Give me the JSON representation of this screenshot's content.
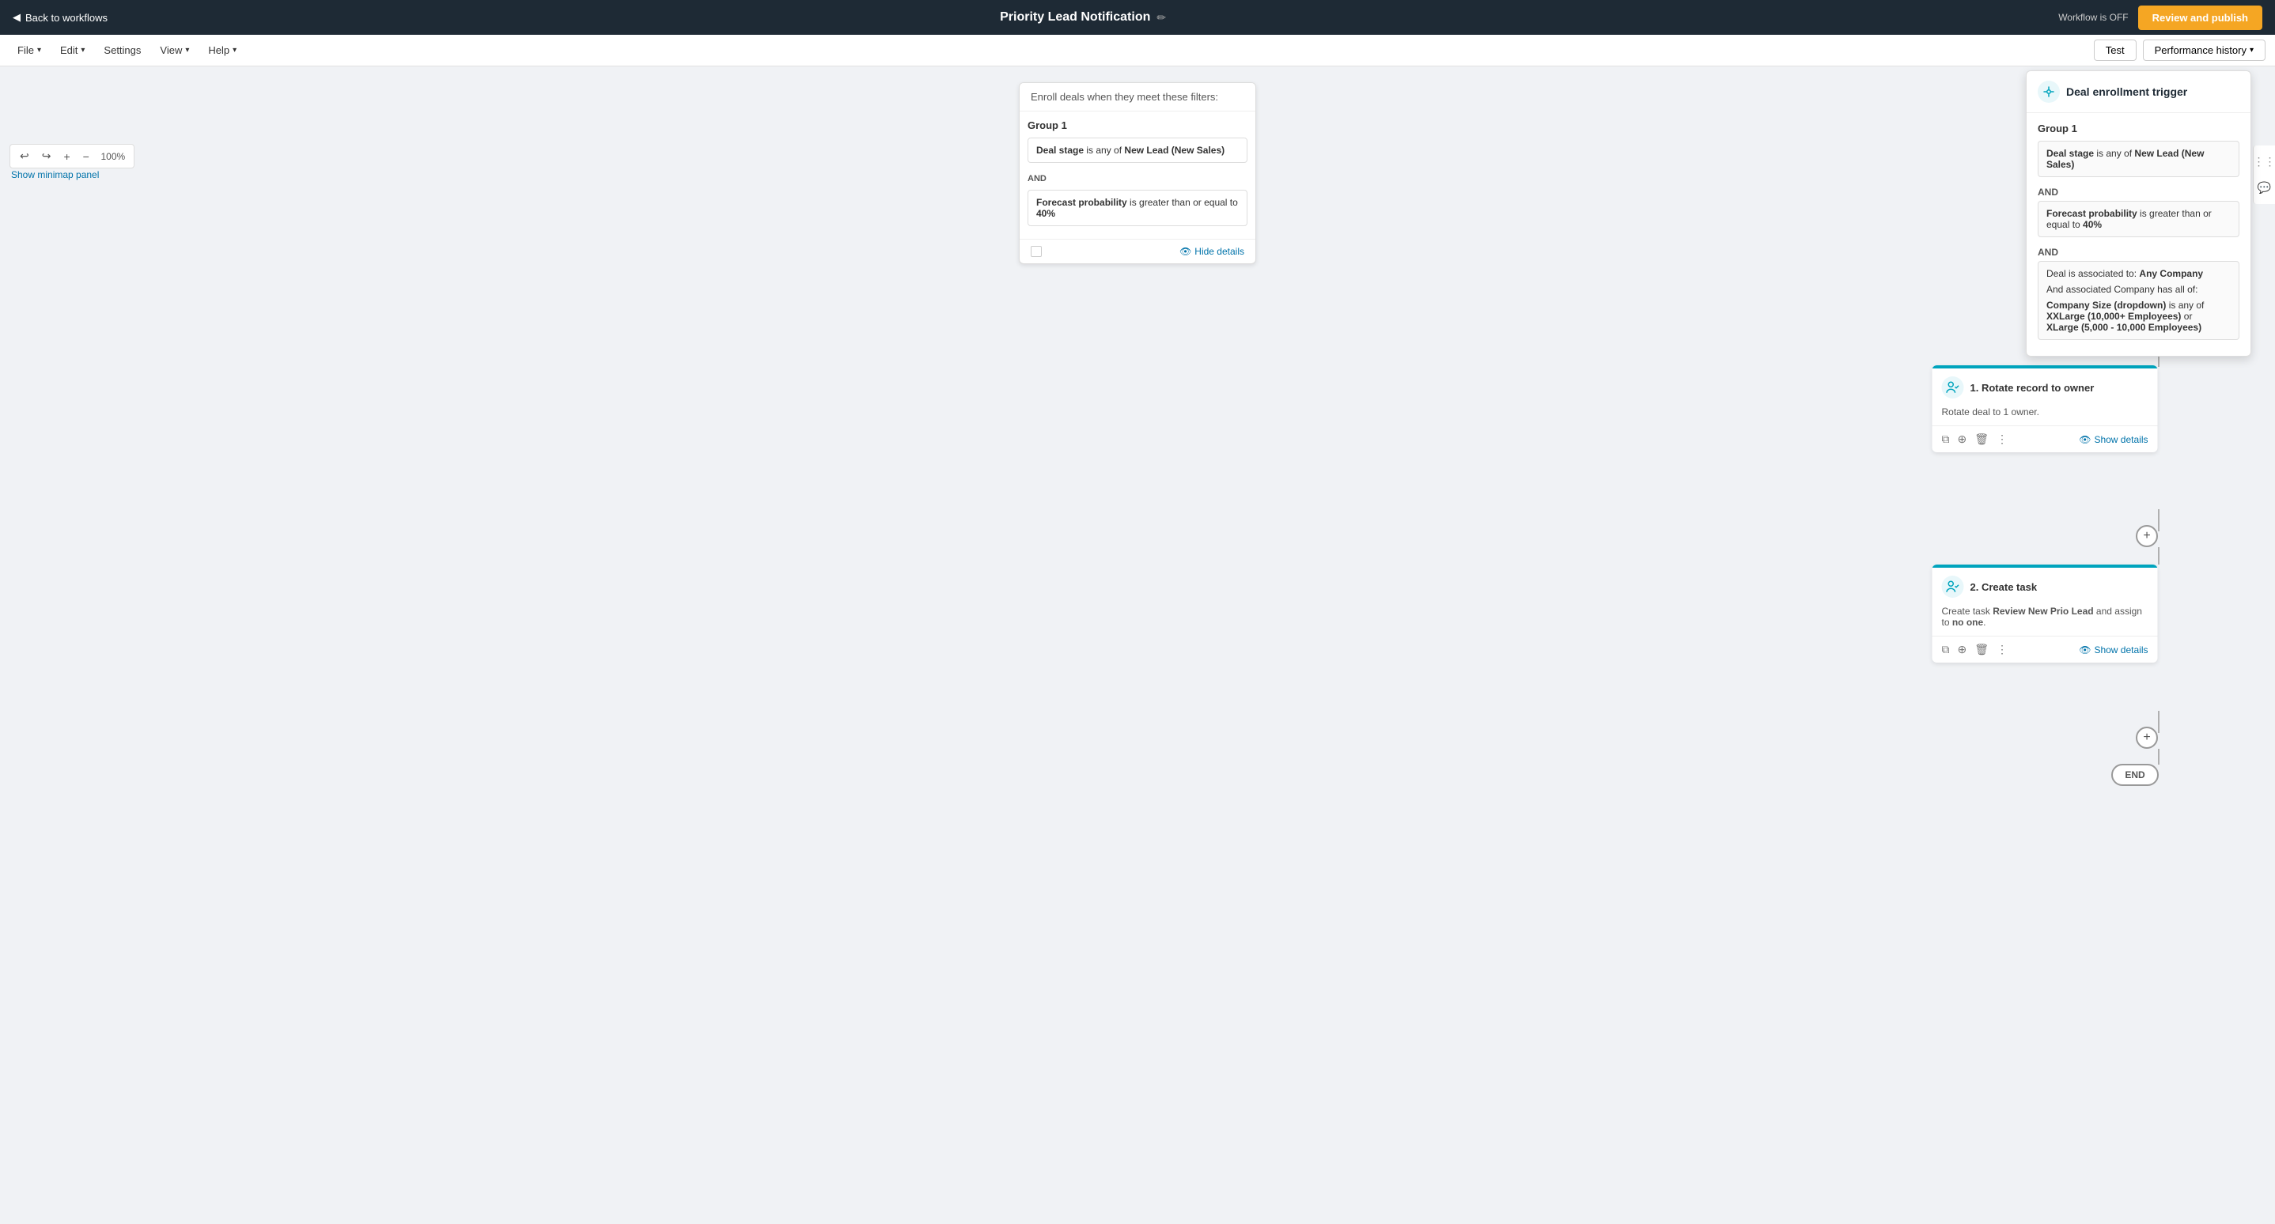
{
  "topnav": {
    "back_label": "Back to workflows",
    "title": "Priority Lead Notification",
    "edit_icon": "✏",
    "workflow_status": "Workflow is OFF",
    "publish_label": "Review and publish"
  },
  "menubar": {
    "file_label": "File",
    "edit_label": "Edit",
    "settings_label": "Settings",
    "view_label": "View",
    "help_label": "Help",
    "test_label": "Test",
    "performance_label": "Performance history"
  },
  "canvas_toolbar": {
    "undo_icon": "↩",
    "redo_icon": "↪",
    "plus_icon": "+",
    "minus_icon": "−",
    "zoom": "100%"
  },
  "minimap": {
    "label": "Show minimap panel"
  },
  "trigger": {
    "header": "Enroll deals when they meet these filters:",
    "group_label": "Group 1",
    "filters": [
      {
        "field": "Deal stage",
        "condition": "is any of",
        "value": "New Lead (New Sales)"
      }
    ],
    "and_label": "AND",
    "filters2": [
      {
        "field": "Forecast probability",
        "condition": "is greater than or equal to",
        "value": "40%"
      }
    ],
    "hide_details": "Hide details"
  },
  "add_buttons": [
    {
      "id": "add1",
      "symbol": "+"
    },
    {
      "id": "add2",
      "symbol": "+"
    },
    {
      "id": "add3",
      "symbol": "+"
    }
  ],
  "actions": [
    {
      "number": "1",
      "title": "1. Rotate record to owner",
      "description": "Rotate deal to 1 owner.",
      "show_details": "Show details",
      "icon": "👥"
    },
    {
      "number": "2",
      "title": "2. Create task",
      "description_pre": "Create task ",
      "description_bold": "Review New Prio Lead",
      "description_post": " and assign to ",
      "description_bold2": "no one",
      "description_end": ".",
      "show_details": "Show details",
      "icon": "👥"
    }
  ],
  "end_node": {
    "label": "END"
  },
  "detail_panel": {
    "icon": "🔄",
    "title": "Deal enrollment trigger",
    "group_label": "Group 1",
    "filters": [
      {
        "field": "Deal stage",
        "condition": "is any of",
        "value": "New Lead (New Sales)"
      }
    ],
    "and1": "AND",
    "filters2": [
      {
        "field": "Forecast probability",
        "condition": "is greater than or equal to",
        "value": "40%"
      }
    ],
    "and2": "AND",
    "filters3_pre": "Deal is associated to: ",
    "filters3_bold": "Any Company",
    "filters3_sub": "And associated Company has all of:",
    "filters3_field": "Company Size (dropdown)",
    "filters3_condition": "is any of",
    "filters3_value": "XXLarge (10,000+ Employees)",
    "filters3_or": "or",
    "filters3_value2": "XLarge (5,000 - 10,000 Employees)"
  }
}
